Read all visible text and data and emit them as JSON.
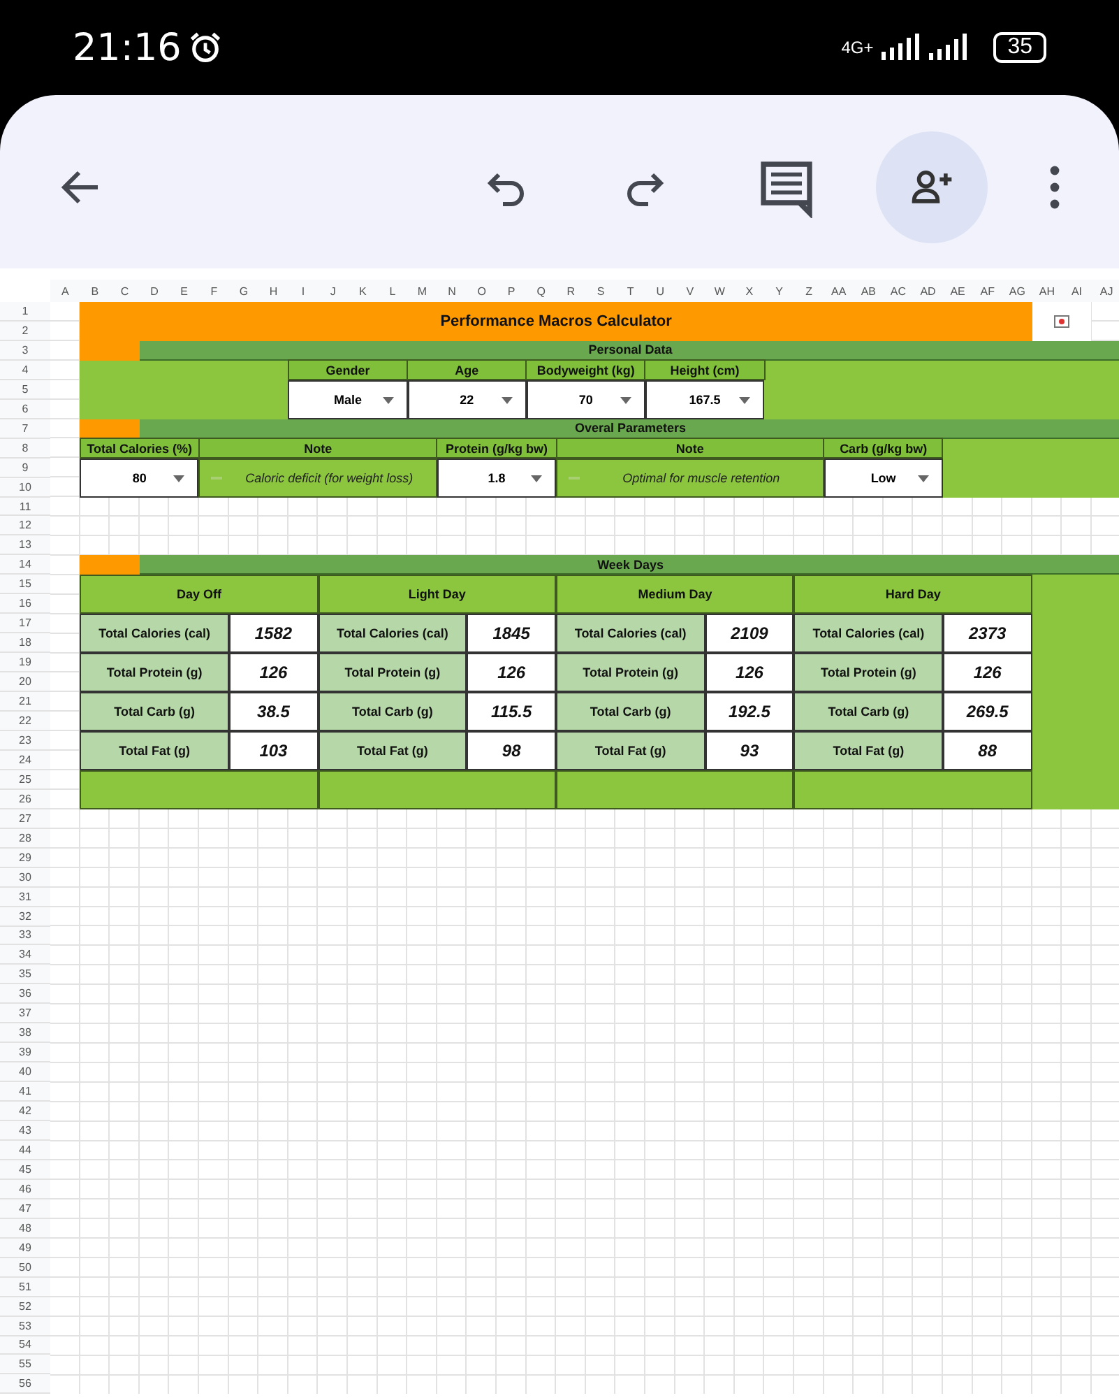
{
  "status_bar": {
    "time": "21:16",
    "network": "4G+",
    "battery": "35"
  },
  "sheet": {
    "column_letters": [
      "A",
      "B",
      "C",
      "D",
      "E",
      "F",
      "G",
      "H",
      "I",
      "J",
      "K",
      "L",
      "M",
      "N",
      "O",
      "P",
      "Q",
      "R",
      "S",
      "T",
      "U",
      "V",
      "W",
      "X",
      "Y",
      "Z",
      "AA",
      "AB",
      "AC",
      "AD",
      "AE",
      "AF",
      "AG",
      "AH",
      "AI",
      "AJ"
    ],
    "row_numbers": [
      "1",
      "2",
      "3",
      "4",
      "5",
      "6",
      "7",
      "8",
      "9",
      "10",
      "11",
      "12",
      "13",
      "14",
      "15",
      "16",
      "17",
      "18",
      "19",
      "20",
      "21",
      "22",
      "23",
      "24",
      "25",
      "26",
      "27",
      "28",
      "29",
      "30",
      "31",
      "32",
      "33",
      "34",
      "35",
      "36",
      "37",
      "38",
      "39",
      "40",
      "41",
      "42",
      "43",
      "44",
      "45",
      "46",
      "47",
      "48",
      "49",
      "50",
      "51",
      "52",
      "53",
      "54",
      "55",
      "56"
    ],
    "title": "Performance Macros Calculator",
    "personal_data": {
      "heading": "Personal Data",
      "fields": [
        {
          "label": "Gender",
          "value": "Male"
        },
        {
          "label": "Age",
          "value": "22"
        },
        {
          "label": "Bodyweight (kg)",
          "value": "70"
        },
        {
          "label": "Height (cm)",
          "value": "167.5"
        }
      ]
    },
    "overall_parameters": {
      "heading": "Overal Parameters",
      "items": [
        {
          "kind": "dropdown",
          "label": "Total Calories (%)",
          "value": "80"
        },
        {
          "kind": "note",
          "label": "Note",
          "value": "Caloric deficit (for weight loss)"
        },
        {
          "kind": "dropdown",
          "label": "Protein (g/kg bw)",
          "value": "1.8"
        },
        {
          "kind": "note",
          "label": "Note",
          "value": "Optimal for muscle retention"
        },
        {
          "kind": "dropdown",
          "label": "Carb (g/kg bw)",
          "value": "Low"
        }
      ]
    },
    "week_days": {
      "heading": "Week Days",
      "days": [
        {
          "name": "Day Off",
          "rows": [
            {
              "label": "Total Calories (cal)",
              "value": "1582"
            },
            {
              "label": "Total Protein (g)",
              "value": "126"
            },
            {
              "label": "Total Carb (g)",
              "value": "38.5"
            },
            {
              "label": "Total Fat (g)",
              "value": "103"
            }
          ]
        },
        {
          "name": "Light Day",
          "rows": [
            {
              "label": "Total Calories (cal)",
              "value": "1845"
            },
            {
              "label": "Total Protein (g)",
              "value": "126"
            },
            {
              "label": "Total Carb (g)",
              "value": "115.5"
            },
            {
              "label": "Total Fat (g)",
              "value": "98"
            }
          ]
        },
        {
          "name": "Medium Day",
          "rows": [
            {
              "label": "Total Calories (cal)",
              "value": "2109"
            },
            {
              "label": "Total Protein (g)",
              "value": "126"
            },
            {
              "label": "Total Carb (g)",
              "value": "192.5"
            },
            {
              "label": "Total Fat (g)",
              "value": "93"
            }
          ]
        },
        {
          "name": "Hard Day",
          "rows": [
            {
              "label": "Total Calories (cal)",
              "value": "2373"
            },
            {
              "label": "Total Protein (g)",
              "value": "126"
            },
            {
              "label": "Total Carb (g)",
              "value": "269.5"
            },
            {
              "label": "Total Fat (g)",
              "value": "88"
            }
          ]
        }
      ]
    }
  }
}
